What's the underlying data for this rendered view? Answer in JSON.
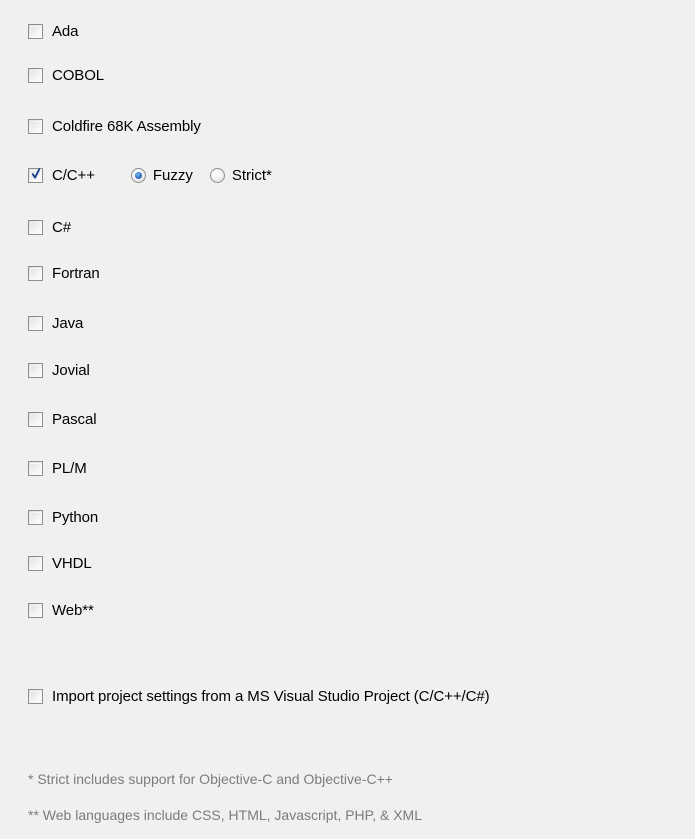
{
  "languages": [
    {
      "label": "Ada",
      "checked": false
    },
    {
      "label": "COBOL",
      "checked": false
    },
    {
      "label": "Coldfire 68K Assembly",
      "checked": false
    },
    {
      "label": "C/C++",
      "checked": true
    },
    {
      "label": "C#",
      "checked": false
    },
    {
      "label": "Fortran",
      "checked": false
    },
    {
      "label": "Java",
      "checked": false
    },
    {
      "label": "Jovial",
      "checked": false
    },
    {
      "label": "Pascal",
      "checked": false
    },
    {
      "label": "PL/M",
      "checked": false
    },
    {
      "label": "Python",
      "checked": false
    },
    {
      "label": "VHDL",
      "checked": false
    },
    {
      "label": "Web**",
      "checked": false
    }
  ],
  "cpp_mode": {
    "options": [
      {
        "label": "Fuzzy",
        "selected": true
      },
      {
        "label": "Strict*",
        "selected": false
      }
    ]
  },
  "import_option": {
    "label": "Import project settings from a MS Visual Studio Project (C/C++/C#)",
    "checked": false
  },
  "notes": {
    "strict": "* Strict includes support for Objective-C and Objective-C++",
    "web": "** Web languages include CSS, HTML, Javascript, PHP, & XML"
  },
  "colors": {
    "background": "#f0f0f0",
    "note_text": "#7c7c7c",
    "check_mark": "#1c3f8f",
    "radio_dot": "#2c6fc0"
  }
}
